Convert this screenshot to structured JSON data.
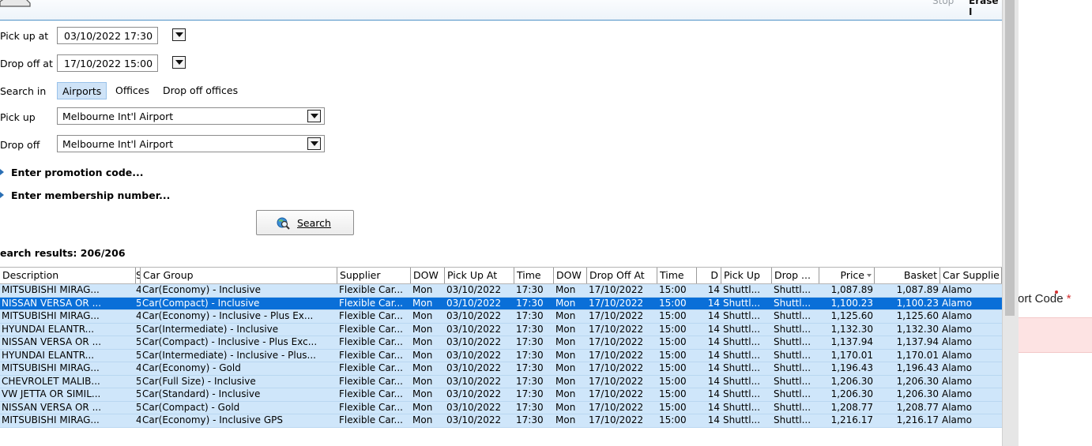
{
  "header": {
    "stop_label": "Stop",
    "erase_label": "Erase I"
  },
  "form": {
    "pickup_at_label": "Pick up at",
    "pickup_at_value": "03/10/2022 17:30",
    "dropoff_at_label": "Drop off at",
    "dropoff_at_value": "17/10/2022 15:00",
    "search_in_label": "Search in",
    "search_in_options": [
      "Airports",
      "Offices",
      "Drop off offices"
    ],
    "search_in_selected": "Airports",
    "pickup_label": "Pick up",
    "pickup_value": "Melbourne Int'l Airport",
    "dropoff_label": "Drop off",
    "dropoff_value": "Melbourne Int'l Airport",
    "promo_label": "Enter promotion code...",
    "membership_label": "Enter membership number...",
    "search_button": "Search"
  },
  "results": {
    "label": "earch results: 206/206",
    "columns": [
      "Description",
      "S",
      "Car Group",
      "Supplier",
      "DOW",
      "Pick Up At",
      "Time",
      "DOW",
      "Drop Off At",
      "Time",
      "D",
      "Pick Up",
      "Drop ...",
      "Price",
      "Basket",
      "Car Supplie"
    ],
    "sorted_column": "Price",
    "selected_row": 1,
    "rows": [
      [
        "MITSUBISHI MIRAG...",
        "4",
        "Car(Economy) - Inclusive",
        "Flexible Car...",
        "Mon",
        "03/10/2022",
        "17:30",
        "Mon",
        "17/10/2022",
        "15:00",
        "14",
        "Shuttl...",
        "Shuttl...",
        "1,087.89",
        "1,087.89",
        "Alamo"
      ],
      [
        "NISSAN VERSA OR ...",
        "5",
        "Car(Compact) - Inclusive",
        "Flexible Car...",
        "Mon",
        "03/10/2022",
        "17:30",
        "Mon",
        "17/10/2022",
        "15:00",
        "14",
        "Shuttl...",
        "Shuttl...",
        "1,100.23",
        "1,100.23",
        "Alamo"
      ],
      [
        "MITSUBISHI MIRAG...",
        "4",
        "Car(Economy) - Inclusive - Plus Ex...",
        "Flexible Car...",
        "Mon",
        "03/10/2022",
        "17:30",
        "Mon",
        "17/10/2022",
        "15:00",
        "14",
        "Shuttl...",
        "Shuttl...",
        "1,125.60",
        "1,125.60",
        "Alamo"
      ],
      [
        "HYUNDAI ELANTR...",
        "5",
        "Car(Intermediate) - Inclusive",
        "Flexible Car...",
        "Mon",
        "03/10/2022",
        "17:30",
        "Mon",
        "17/10/2022",
        "15:00",
        "14",
        "Shuttl...",
        "Shuttl...",
        "1,132.30",
        "1,132.30",
        "Alamo"
      ],
      [
        "NISSAN VERSA OR ...",
        "5",
        "Car(Compact) - Inclusive - Plus Exc...",
        "Flexible Car...",
        "Mon",
        "03/10/2022",
        "17:30",
        "Mon",
        "17/10/2022",
        "15:00",
        "14",
        "Shuttl...",
        "Shuttl...",
        "1,137.94",
        "1,137.94",
        "Alamo"
      ],
      [
        "HYUNDAI ELANTR...",
        "5",
        "Car(Intermediate) - Inclusive - Plus...",
        "Flexible Car...",
        "Mon",
        "03/10/2022",
        "17:30",
        "Mon",
        "17/10/2022",
        "15:00",
        "14",
        "Shuttl...",
        "Shuttl...",
        "1,170.01",
        "1,170.01",
        "Alamo"
      ],
      [
        "MITSUBISHI MIRAG...",
        "4",
        "Car(Economy) - Gold",
        "Flexible Car...",
        "Mon",
        "03/10/2022",
        "17:30",
        "Mon",
        "17/10/2022",
        "15:00",
        "14",
        "Shuttl...",
        "Shuttl...",
        "1,196.43",
        "1,196.43",
        "Alamo"
      ],
      [
        "CHEVROLET MALIB...",
        "5",
        "Car(Full Size) - Inclusive",
        "Flexible Car...",
        "Mon",
        "03/10/2022",
        "17:30",
        "Mon",
        "17/10/2022",
        "15:00",
        "14",
        "Shuttl...",
        "Shuttl...",
        "1,206.30",
        "1,206.30",
        "Alamo"
      ],
      [
        "VW JETTA OR SIMIL...",
        "5",
        "Car(Standard) - Inclusive",
        "Flexible Car...",
        "Mon",
        "03/10/2022",
        "17:30",
        "Mon",
        "17/10/2022",
        "15:00",
        "14",
        "Shuttl...",
        "Shuttl...",
        "1,206.30",
        "1,206.30",
        "Alamo"
      ],
      [
        "NISSAN VERSA OR ...",
        "5",
        "Car(Compact) - Gold",
        "Flexible Car...",
        "Mon",
        "03/10/2022",
        "17:30",
        "Mon",
        "17/10/2022",
        "15:00",
        "14",
        "Shuttl...",
        "Shuttl...",
        "1,208.77",
        "1,208.77",
        "Alamo"
      ],
      [
        "MITSUBISHI MIRAG...",
        "4",
        "Car(Economy) - Inclusive GPS",
        "Flexible Car...",
        "Mon",
        "03/10/2022",
        "17:30",
        "Mon",
        "17/10/2022",
        "15:00",
        "14",
        "Shuttl...",
        "Shuttl...",
        "1,216.17",
        "1,216.17",
        "Alamo"
      ]
    ]
  },
  "background_page": {
    "field_label_visible": "ort Code",
    "required_marker": "*"
  },
  "colors": {
    "row_bg": "#cfe6fa",
    "row_selected_bg": "#0a6fd8",
    "header_rule": "#4f92c6",
    "error_field_bg": "#fde3e3",
    "required": "#d32f2f"
  },
  "icons": {
    "search_button_icon": "globe-magnifier-icon",
    "dropdown_icon": "chevron-down-icon",
    "expander_icon": "triangle-right-icon",
    "sort_icon": "sort-desc-icon",
    "header_icon": "car-icon"
  }
}
